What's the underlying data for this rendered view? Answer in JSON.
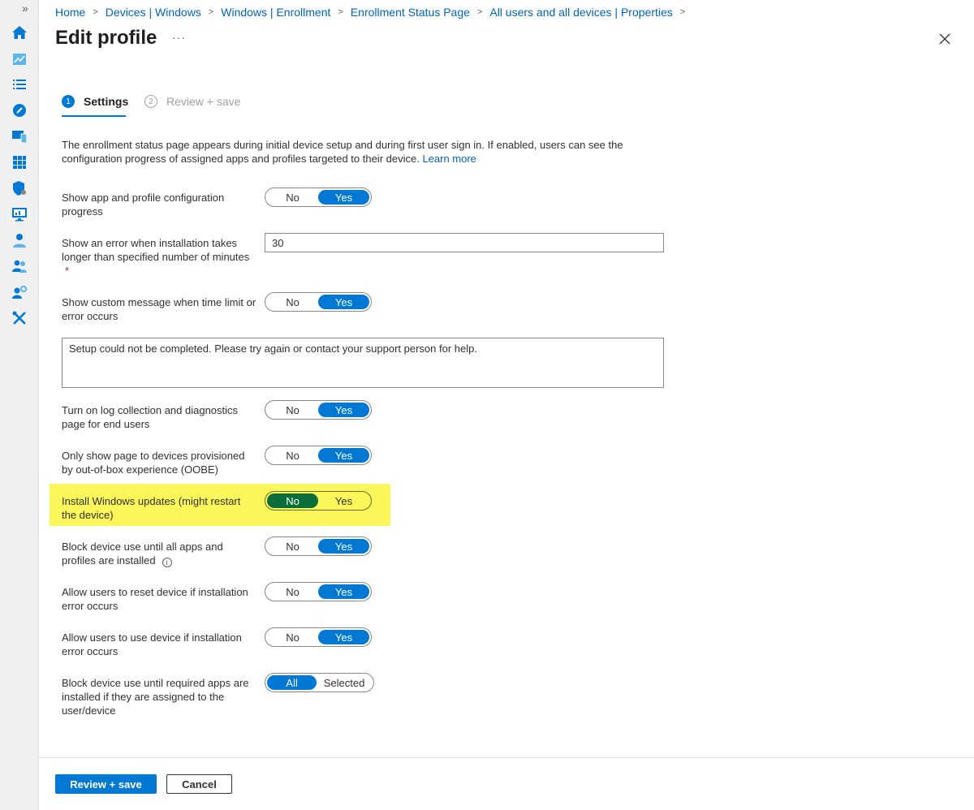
{
  "nav_rail": {
    "expand_label": "»",
    "icons": [
      "home-icon",
      "dashboard-icon",
      "all-services-icon",
      "favorite-icon",
      "devices-icon",
      "apps-icon",
      "endpoint-security-icon",
      "reports-icon",
      "users-icon",
      "groups-icon",
      "tenant-admin-icon",
      "troubleshooting-icon"
    ]
  },
  "breadcrumb": {
    "items": [
      "Home",
      "Devices | Windows",
      "Windows | Enrollment",
      "Enrollment Status Page",
      "All users and all devices | Properties"
    ],
    "separator": ">"
  },
  "header": {
    "title": "Edit profile",
    "more_label": "···"
  },
  "steps": [
    {
      "number": "1",
      "label": "Settings"
    },
    {
      "number": "2",
      "label": "Review + save"
    }
  ],
  "intro": {
    "text": "The enrollment status page appears during initial device setup and during first user sign in. If enabled, users can see the configuration progress of assigned apps and profiles targeted to their device. ",
    "link": "Learn more"
  },
  "settings": {
    "show_progress": {
      "label": "Show app and profile configuration progress",
      "options": [
        "No",
        "Yes"
      ],
      "selected": "Yes"
    },
    "error_minutes": {
      "label": "Show an error when installation takes longer than specified number of minutes",
      "required_mark": "*",
      "value": "30"
    },
    "custom_message": {
      "label": "Show custom message when time limit or error occurs",
      "options": [
        "No",
        "Yes"
      ],
      "selected": "Yes"
    },
    "message_text": "Setup could not be completed. Please try again or contact your support person for help.",
    "log_collection": {
      "label": "Turn on log collection and diagnostics page for end users",
      "options": [
        "No",
        "Yes"
      ],
      "selected": "Yes"
    },
    "oobe_only": {
      "label": "Only show page to devices provisioned by out-of-box experience (OOBE)",
      "options": [
        "No",
        "Yes"
      ],
      "selected": "Yes"
    },
    "windows_updates": {
      "label": "Install Windows updates (might restart the device)",
      "options": [
        "No",
        "Yes"
      ],
      "selected": "No"
    },
    "block_until_installed": {
      "label": "Block device use until all apps and profiles are installed",
      "info_icon": "i",
      "options": [
        "No",
        "Yes"
      ],
      "selected": "Yes"
    },
    "allow_reset": {
      "label": "Allow users to reset device if installation error occurs",
      "options": [
        "No",
        "Yes"
      ],
      "selected": "Yes"
    },
    "allow_use": {
      "label": "Allow users to use device if installation error occurs",
      "options": [
        "No",
        "Yes"
      ],
      "selected": "Yes"
    },
    "block_required_apps": {
      "label": "Block device use until required apps are installed if they are assigned to the user/device",
      "options": [
        "All",
        "Selected"
      ],
      "selected": "All"
    }
  },
  "footer": {
    "primary_label": "Review + save",
    "secondary_label": "Cancel"
  },
  "colors": {
    "accent": "#0078d4",
    "link": "#0064bf",
    "highlight": "#fbf75b",
    "highlight_selected": "#0a6d3a",
    "required": "#a4262c"
  }
}
